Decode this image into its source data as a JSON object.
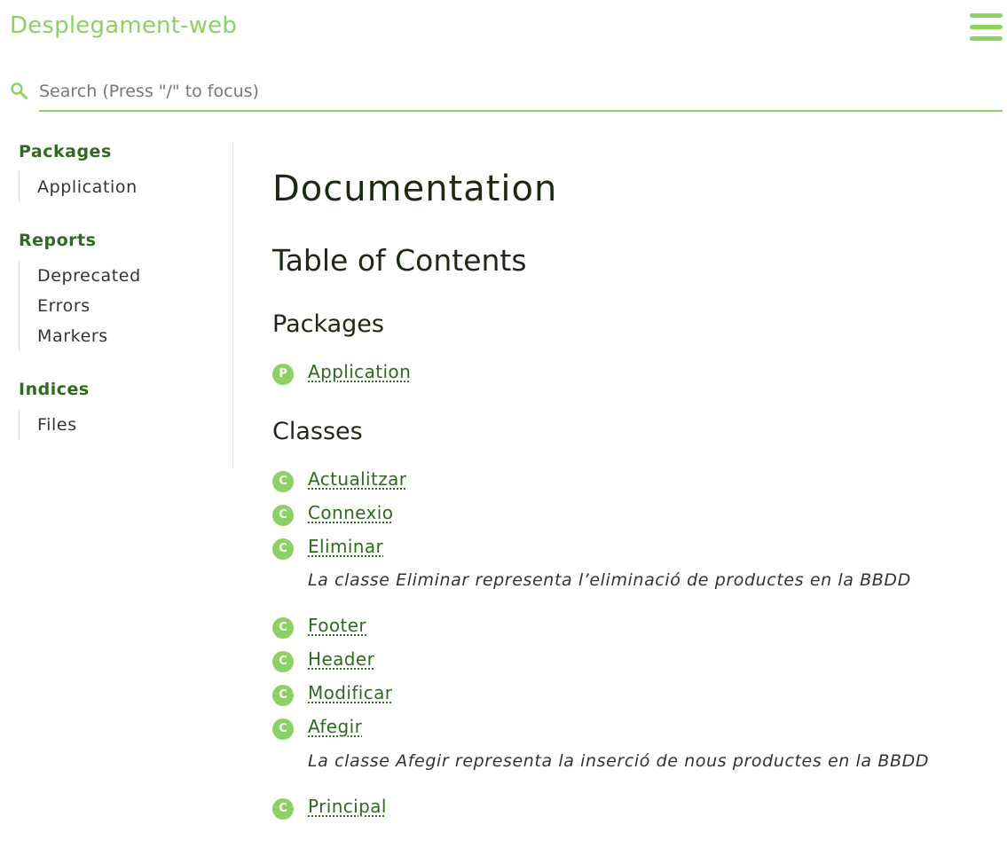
{
  "header": {
    "title": "Desplegament-web",
    "menu_icon": "hamburger-menu-icon"
  },
  "search": {
    "placeholder": "Search (Press \"/\" to focus)",
    "value": "",
    "icon": "search-icon"
  },
  "sidebar": {
    "sections": [
      {
        "heading": "Packages",
        "items": [
          "Application"
        ]
      },
      {
        "heading": "Reports",
        "items": [
          "Deprecated",
          "Errors",
          "Markers"
        ]
      },
      {
        "heading": "Indices",
        "items": [
          "Files"
        ]
      }
    ]
  },
  "main": {
    "title": "Documentation",
    "toc_title": "Table of Contents",
    "packages_heading": "Packages",
    "packages": [
      {
        "badge": "P",
        "name": "Application"
      }
    ],
    "classes_heading": "Classes",
    "classes": [
      {
        "badge": "C",
        "name": "Actualitzar",
        "description": ""
      },
      {
        "badge": "C",
        "name": "Connexio",
        "description": ""
      },
      {
        "badge": "C",
        "name": "Eliminar",
        "description": "La classe Eliminar representa l’eliminació de productes en la BBDD"
      },
      {
        "badge": "C",
        "name": "Footer",
        "description": ""
      },
      {
        "badge": "C",
        "name": "Header",
        "description": ""
      },
      {
        "badge": "C",
        "name": "Modificar",
        "description": ""
      },
      {
        "badge": "C",
        "name": "Afegir",
        "description": "La classe Afegir representa la inserció de nous productes en la BBDD"
      },
      {
        "badge": "C",
        "name": "Principal",
        "description": ""
      }
    ]
  },
  "colors": {
    "accent": "#8cd164",
    "link": "#2f6a1f",
    "heading": "#1c2a14"
  }
}
